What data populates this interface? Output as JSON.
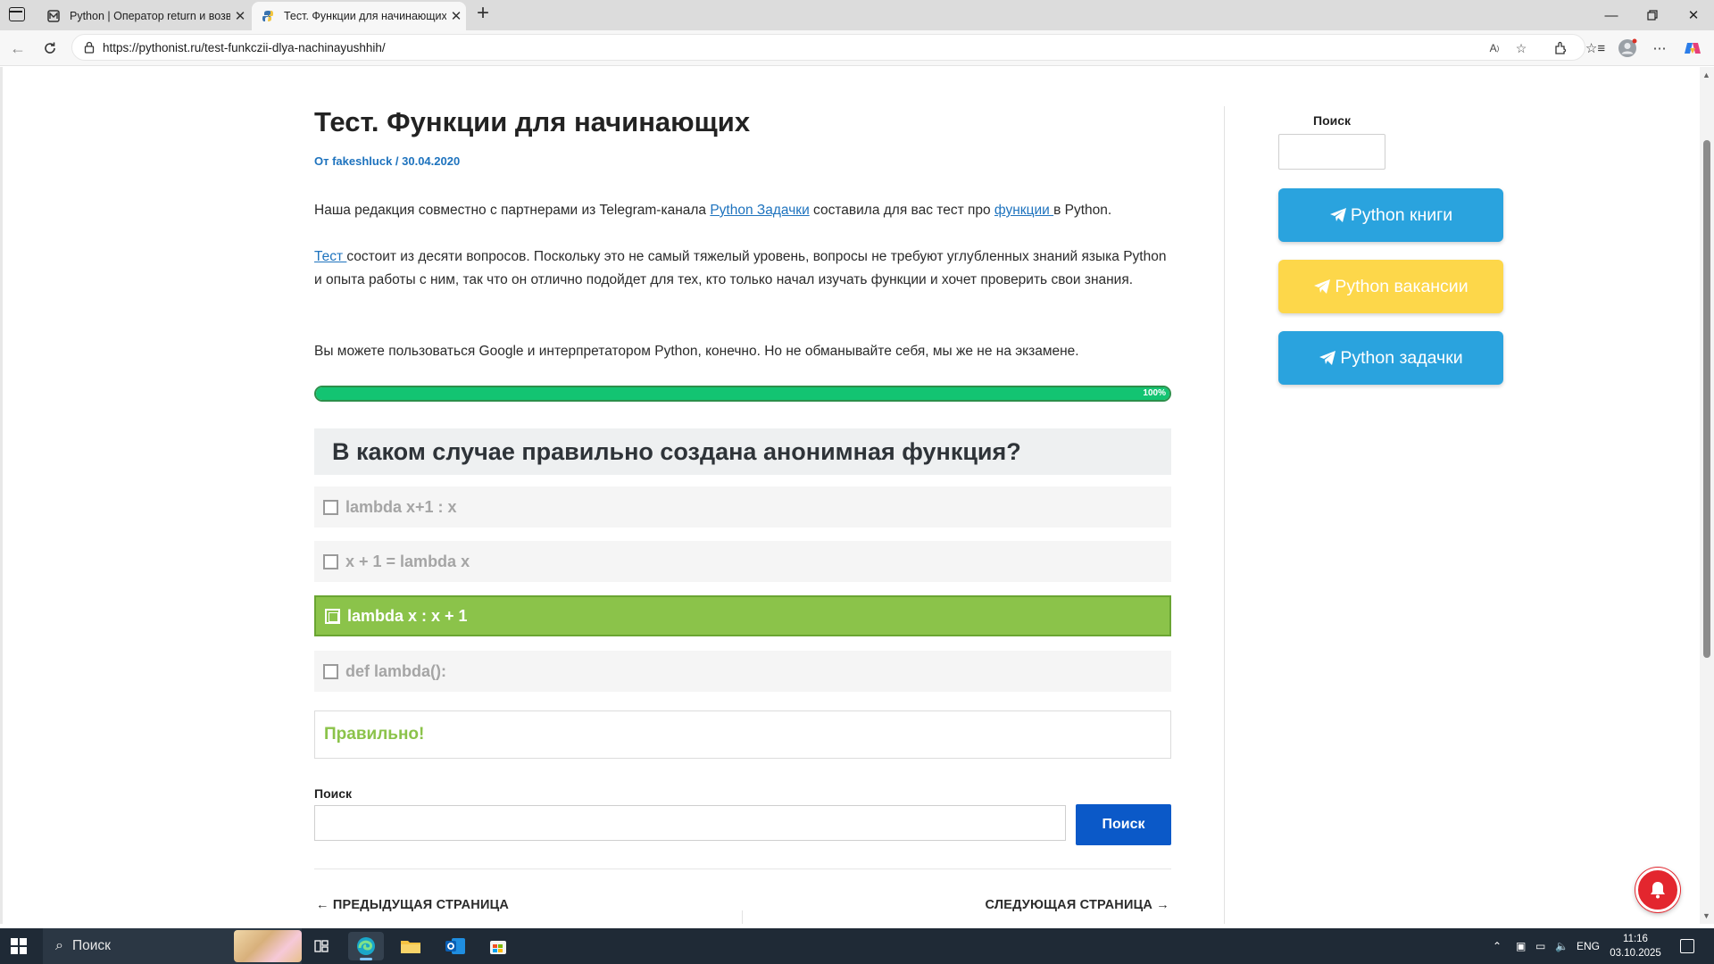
{
  "browser": {
    "tabs": [
      {
        "title": "Python | Оператор return и возв",
        "active": false
      },
      {
        "title": "Тест. Функции для начинающих",
        "active": true
      }
    ],
    "url": "https://pythonist.ru/test-funkczii-dlya-nachinayushhih/"
  },
  "post": {
    "title": "Тест. Функции для начинающих",
    "meta": "От fakeshluck / 30.04.2020",
    "intro": {
      "before": "Наша редакция совместно с партнерами из Telegram-канала ",
      "link1": "Python Задачки",
      "middle": " составила для вас тест про ",
      "link2": "функции ",
      "after": "в Python."
    },
    "para2": {
      "link": "Тест ",
      "text": "состоит из десяти вопросов. Поскольку это не самый тяжелый уровень, вопросы не требуют углубленных знаний языка Python и опыта работы с ним, так что он отлично подойдет для тех, кто только начал изучать функции и хочет проверить свои знания."
    },
    "para3": "Вы можете пользоваться Google и интерпретатором Python, конечно. Но не обманывайте себя, мы же не на экзамене."
  },
  "quiz": {
    "progress_percent": 100,
    "progress_label": "100%",
    "question": "В каком случае правильно создана анонимная функция?",
    "answers": [
      {
        "text": "lambda x+1 : x",
        "correct": false
      },
      {
        "text": "x + 1 = lambda x",
        "correct": false
      },
      {
        "text": "lambda x : x + 1",
        "correct": true
      },
      {
        "text": "def lambda():",
        "correct": false
      }
    ],
    "result": "Правильно!"
  },
  "search": {
    "label": "Поиск",
    "button": "Поиск"
  },
  "pagination": {
    "prev": "← ПРЕДЫДУЩАЯ СТРАНИЦА",
    "next": "СЛЕДУЮЩАЯ СТРАНИЦА →"
  },
  "sidebar": {
    "search_label": "Поиск",
    "buttons": [
      {
        "label": "Python книги",
        "color": "#2aa3de"
      },
      {
        "label": "Python вакансии",
        "color": "#fdd74a"
      },
      {
        "label": "Python задачки",
        "color": "#2aa3de"
      }
    ]
  },
  "taskbar": {
    "search_placeholder": "Поиск",
    "language": "ENG",
    "time": "11:16",
    "date": "03.10.2025"
  }
}
